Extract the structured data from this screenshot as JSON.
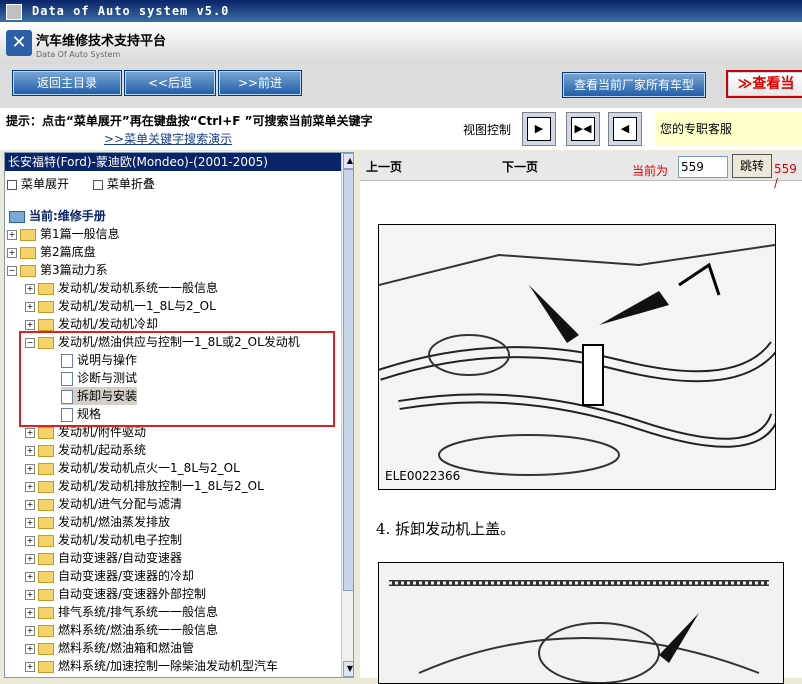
{
  "window": {
    "title": "Data of Auto system v5.0"
  },
  "header": {
    "title_cn": "汽车维修技术支持平台",
    "title_en": "Data Of Auto System"
  },
  "toolbar": {
    "main_menu": "返回主目录",
    "back": "<<后退",
    "forward": ">>前进",
    "all_models": "查看当前厂家所有车型",
    "view_partial": "≫查看当"
  },
  "hint": {
    "text": "提示：点击“菜单展开”再在键盘按“Ctrl+F ”可搜索当前菜单关键字",
    "link": ">>菜单关键字搜索演示",
    "view_label": "视图控制",
    "support": "您的专职客服"
  },
  "tree": {
    "header": "长安福特(Ford)-蒙迪欧(Mondeo)-(2001-2005)",
    "expand": "菜单展开",
    "collapse": "菜单折叠",
    "current": "当前:维修手册",
    "items": [
      "第1篇一般信息",
      "第2篇底盘",
      "第3篇动力系",
      "发动机/发动机系统一一般信息",
      "发动机/发动机一1_8L与2_OL",
      "发动机/发动机冷却",
      "发动机/燃油供应与控制一1_8L或2_OL发动机",
      "说明与操作",
      "诊断与测试",
      "拆卸与安装",
      "规格",
      "发动机/附件驱动",
      "发动机/起动系统",
      "发动机/发动机点火一1_8L与2_OL",
      "发动机/发动机排放控制一1_8L与2_OL",
      "发动机/进气分配与滤清",
      "发动机/燃油蒸发排放",
      "发动机/发动机电子控制",
      "自动变速器/自动变速器",
      "自动变速器/变速器的冷却",
      "自动变速器/变速器外部控制",
      "排气系统/排气系统一一般信息",
      "燃料系统/燃油系统一一般信息",
      "燃料系统/燃油箱和燃油管",
      "燃料系统/加速控制一除柴油发动机型汽车"
    ]
  },
  "viewer": {
    "prev": "上一页",
    "next": "下一页",
    "current_label": "当前为",
    "page": "559",
    "jump": "跳转",
    "count": "559 /",
    "figure_code": "ELE0022366",
    "step_text": "4.   拆卸发动机上盖。"
  }
}
